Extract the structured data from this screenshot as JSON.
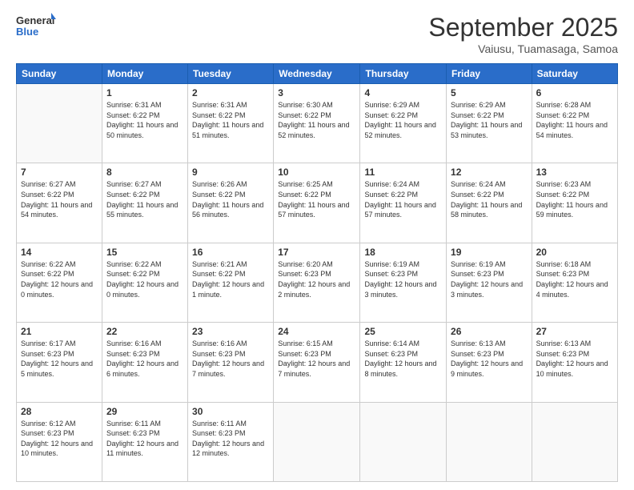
{
  "header": {
    "logo_general": "General",
    "logo_blue": "Blue",
    "month": "September 2025",
    "location": "Vaiusu, Tuamasaga, Samoa"
  },
  "weekdays": [
    "Sunday",
    "Monday",
    "Tuesday",
    "Wednesday",
    "Thursday",
    "Friday",
    "Saturday"
  ],
  "weeks": [
    [
      {
        "day": "",
        "sunrise": "",
        "sunset": "",
        "daylight": ""
      },
      {
        "day": "1",
        "sunrise": "Sunrise: 6:31 AM",
        "sunset": "Sunset: 6:22 PM",
        "daylight": "Daylight: 11 hours and 50 minutes."
      },
      {
        "day": "2",
        "sunrise": "Sunrise: 6:31 AM",
        "sunset": "Sunset: 6:22 PM",
        "daylight": "Daylight: 11 hours and 51 minutes."
      },
      {
        "day": "3",
        "sunrise": "Sunrise: 6:30 AM",
        "sunset": "Sunset: 6:22 PM",
        "daylight": "Daylight: 11 hours and 52 minutes."
      },
      {
        "day": "4",
        "sunrise": "Sunrise: 6:29 AM",
        "sunset": "Sunset: 6:22 PM",
        "daylight": "Daylight: 11 hours and 52 minutes."
      },
      {
        "day": "5",
        "sunrise": "Sunrise: 6:29 AM",
        "sunset": "Sunset: 6:22 PM",
        "daylight": "Daylight: 11 hours and 53 minutes."
      },
      {
        "day": "6",
        "sunrise": "Sunrise: 6:28 AM",
        "sunset": "Sunset: 6:22 PM",
        "daylight": "Daylight: 11 hours and 54 minutes."
      }
    ],
    [
      {
        "day": "7",
        "sunrise": "Sunrise: 6:27 AM",
        "sunset": "Sunset: 6:22 PM",
        "daylight": "Daylight: 11 hours and 54 minutes."
      },
      {
        "day": "8",
        "sunrise": "Sunrise: 6:27 AM",
        "sunset": "Sunset: 6:22 PM",
        "daylight": "Daylight: 11 hours and 55 minutes."
      },
      {
        "day": "9",
        "sunrise": "Sunrise: 6:26 AM",
        "sunset": "Sunset: 6:22 PM",
        "daylight": "Daylight: 11 hours and 56 minutes."
      },
      {
        "day": "10",
        "sunrise": "Sunrise: 6:25 AM",
        "sunset": "Sunset: 6:22 PM",
        "daylight": "Daylight: 11 hours and 57 minutes."
      },
      {
        "day": "11",
        "sunrise": "Sunrise: 6:24 AM",
        "sunset": "Sunset: 6:22 PM",
        "daylight": "Daylight: 11 hours and 57 minutes."
      },
      {
        "day": "12",
        "sunrise": "Sunrise: 6:24 AM",
        "sunset": "Sunset: 6:22 PM",
        "daylight": "Daylight: 11 hours and 58 minutes."
      },
      {
        "day": "13",
        "sunrise": "Sunrise: 6:23 AM",
        "sunset": "Sunset: 6:22 PM",
        "daylight": "Daylight: 11 hours and 59 minutes."
      }
    ],
    [
      {
        "day": "14",
        "sunrise": "Sunrise: 6:22 AM",
        "sunset": "Sunset: 6:22 PM",
        "daylight": "Daylight: 12 hours and 0 minutes."
      },
      {
        "day": "15",
        "sunrise": "Sunrise: 6:22 AM",
        "sunset": "Sunset: 6:22 PM",
        "daylight": "Daylight: 12 hours and 0 minutes."
      },
      {
        "day": "16",
        "sunrise": "Sunrise: 6:21 AM",
        "sunset": "Sunset: 6:22 PM",
        "daylight": "Daylight: 12 hours and 1 minute."
      },
      {
        "day": "17",
        "sunrise": "Sunrise: 6:20 AM",
        "sunset": "Sunset: 6:23 PM",
        "daylight": "Daylight: 12 hours and 2 minutes."
      },
      {
        "day": "18",
        "sunrise": "Sunrise: 6:19 AM",
        "sunset": "Sunset: 6:23 PM",
        "daylight": "Daylight: 12 hours and 3 minutes."
      },
      {
        "day": "19",
        "sunrise": "Sunrise: 6:19 AM",
        "sunset": "Sunset: 6:23 PM",
        "daylight": "Daylight: 12 hours and 3 minutes."
      },
      {
        "day": "20",
        "sunrise": "Sunrise: 6:18 AM",
        "sunset": "Sunset: 6:23 PM",
        "daylight": "Daylight: 12 hours and 4 minutes."
      }
    ],
    [
      {
        "day": "21",
        "sunrise": "Sunrise: 6:17 AM",
        "sunset": "Sunset: 6:23 PM",
        "daylight": "Daylight: 12 hours and 5 minutes."
      },
      {
        "day": "22",
        "sunrise": "Sunrise: 6:16 AM",
        "sunset": "Sunset: 6:23 PM",
        "daylight": "Daylight: 12 hours and 6 minutes."
      },
      {
        "day": "23",
        "sunrise": "Sunrise: 6:16 AM",
        "sunset": "Sunset: 6:23 PM",
        "daylight": "Daylight: 12 hours and 7 minutes."
      },
      {
        "day": "24",
        "sunrise": "Sunrise: 6:15 AM",
        "sunset": "Sunset: 6:23 PM",
        "daylight": "Daylight: 12 hours and 7 minutes."
      },
      {
        "day": "25",
        "sunrise": "Sunrise: 6:14 AM",
        "sunset": "Sunset: 6:23 PM",
        "daylight": "Daylight: 12 hours and 8 minutes."
      },
      {
        "day": "26",
        "sunrise": "Sunrise: 6:13 AM",
        "sunset": "Sunset: 6:23 PM",
        "daylight": "Daylight: 12 hours and 9 minutes."
      },
      {
        "day": "27",
        "sunrise": "Sunrise: 6:13 AM",
        "sunset": "Sunset: 6:23 PM",
        "daylight": "Daylight: 12 hours and 10 minutes."
      }
    ],
    [
      {
        "day": "28",
        "sunrise": "Sunrise: 6:12 AM",
        "sunset": "Sunset: 6:23 PM",
        "daylight": "Daylight: 12 hours and 10 minutes."
      },
      {
        "day": "29",
        "sunrise": "Sunrise: 6:11 AM",
        "sunset": "Sunset: 6:23 PM",
        "daylight": "Daylight: 12 hours and 11 minutes."
      },
      {
        "day": "30",
        "sunrise": "Sunrise: 6:11 AM",
        "sunset": "Sunset: 6:23 PM",
        "daylight": "Daylight: 12 hours and 12 minutes."
      },
      {
        "day": "",
        "sunrise": "",
        "sunset": "",
        "daylight": ""
      },
      {
        "day": "",
        "sunrise": "",
        "sunset": "",
        "daylight": ""
      },
      {
        "day": "",
        "sunrise": "",
        "sunset": "",
        "daylight": ""
      },
      {
        "day": "",
        "sunrise": "",
        "sunset": "",
        "daylight": ""
      }
    ]
  ]
}
